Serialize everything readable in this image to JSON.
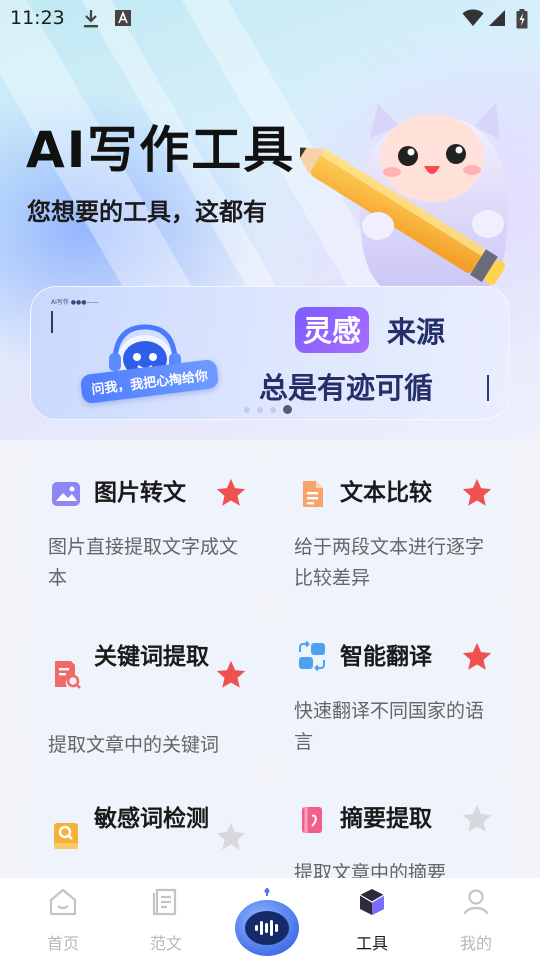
{
  "status_bar": {
    "time": "11:23",
    "icons": [
      "download-icon",
      "a-font-icon",
      "wifi-icon",
      "signal-icon",
      "battery-charging-icon"
    ]
  },
  "hero": {
    "title": "AI写作工具",
    "subtitle": "您想要的工具，这都有"
  },
  "banner": {
    "tag": "AI写作 ●●●——",
    "pill_text": "问我，我把心掏给你",
    "inspire_label": "灵感",
    "source_label": "来源",
    "slogan": "总是有迹可循",
    "dots_total": 4,
    "dots_active_index": 3
  },
  "tools": [
    {
      "title": "图片转文",
      "desc": "图片直接提取文字成文本",
      "icon": "image-icon",
      "starred": true
    },
    {
      "title": "文本比较",
      "desc": "给于两段文本进行逐字比较差异",
      "icon": "document-icon",
      "starred": true
    },
    {
      "title": "关键词提取",
      "desc": "提取文章中的关键词",
      "icon": "keyword-search-icon",
      "starred": true
    },
    {
      "title": "智能翻译",
      "desc": "快速翻译不同国家的语言",
      "icon": "translate-icon",
      "starred": true
    },
    {
      "title": "敏感词检测",
      "desc": "",
      "icon": "sensitive-check-icon",
      "starred": false
    },
    {
      "title": "摘要提取",
      "desc": "提取文章中的摘要",
      "icon": "summary-icon",
      "starred": false
    }
  ],
  "colors": {
    "star_active": "#f0514f",
    "star_inactive": "#d8d8dc",
    "accent_purple": "#8a62ff"
  },
  "bottom_nav": {
    "items": [
      {
        "label": "首页",
        "icon": "home-icon",
        "active": false
      },
      {
        "label": "范文",
        "icon": "essay-icon",
        "active": false
      },
      {
        "label": "",
        "icon": "ai-bot-icon",
        "active": false
      },
      {
        "label": "工具",
        "icon": "cube-icon",
        "active": true
      },
      {
        "label": "我的",
        "icon": "user-icon",
        "active": false
      }
    ]
  }
}
